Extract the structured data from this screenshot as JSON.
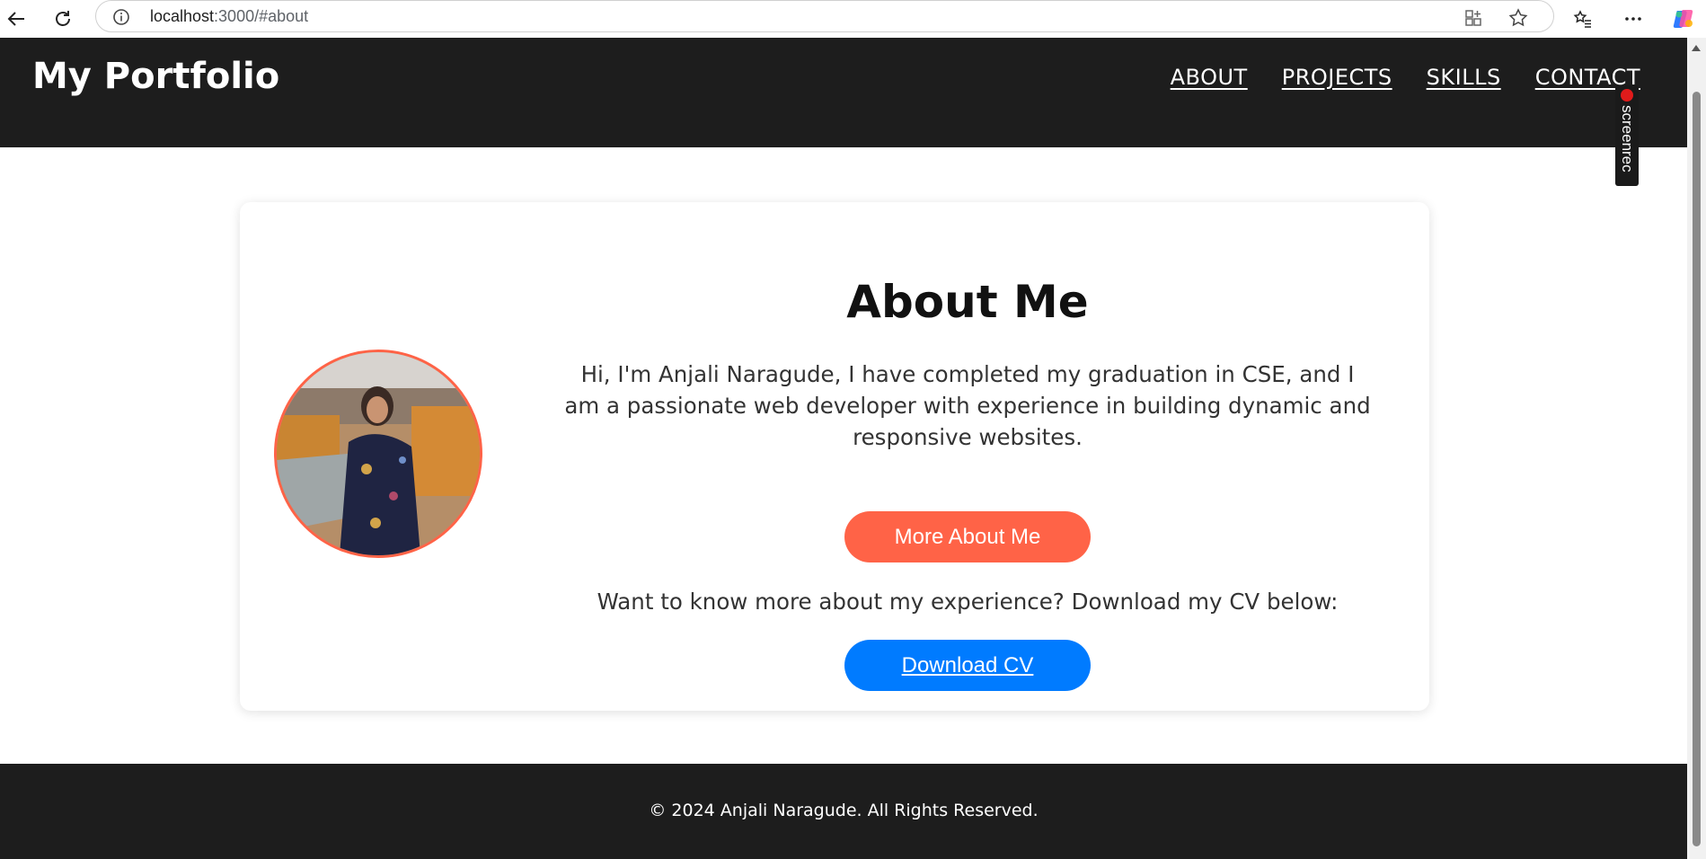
{
  "browser": {
    "url_host": "localhost",
    "url_path": ":3000/#about"
  },
  "header": {
    "brand": "My Portfolio",
    "nav": [
      "ABOUT",
      "PROJECTS",
      "SKILLS",
      "CONTACT"
    ]
  },
  "overlay": {
    "label": "screenrec"
  },
  "about": {
    "title": "About Me",
    "bio": "Hi, I'm Anjali Naragude, I have completed my graduation in CSE, and I am a passionate web developer with experience in building dynamic and responsive websites.",
    "more_button": "More About Me",
    "cv_prompt": "Want to know more about my experience? Download my CV below:",
    "cv_button": "Download CV"
  },
  "footer": {
    "copyright": "© 2024 Anjali Naragude. All Rights Reserved."
  },
  "colors": {
    "accent": "#ff6347",
    "primary": "#007bff",
    "header_bg": "#1d1d1d"
  }
}
